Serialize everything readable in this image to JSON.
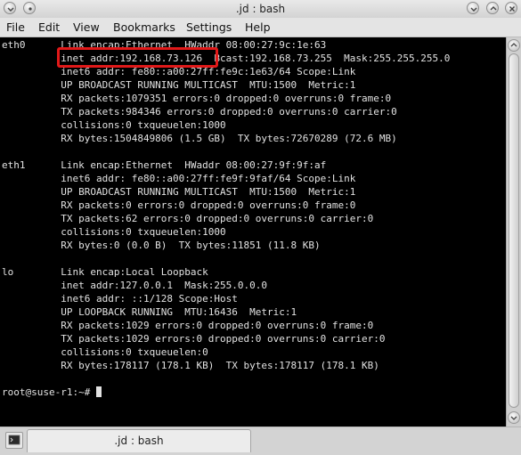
{
  "window": {
    "title": ".jd : bash",
    "icons": [
      "window-menu-icon",
      "pin-icon",
      "minimize-icon",
      "maximize-icon",
      "close-icon"
    ]
  },
  "menubar": {
    "items": [
      {
        "label": "File"
      },
      {
        "label": "Edit"
      },
      {
        "label": "View"
      },
      {
        "label": "Bookmarks"
      },
      {
        "label": "Settings"
      },
      {
        "label": "Help"
      }
    ]
  },
  "terminal": {
    "background": "#000000",
    "text_color": "#e2e2e2",
    "highlight_color": "#e11919",
    "highlighted_text": "inet addr:192.168.73.126",
    "lines": [
      "eth0      Link encap:Ethernet  HWaddr 08:00:27:9c:1e:63",
      "          inet addr:192.168.73.126  Bcast:192.168.73.255  Mask:255.255.255.0",
      "          inet6 addr: fe80::a00:27ff:fe9c:1e63/64 Scope:Link",
      "          UP BROADCAST RUNNING MULTICAST  MTU:1500  Metric:1",
      "          RX packets:1079351 errors:0 dropped:0 overruns:0 frame:0",
      "          TX packets:984346 errors:0 dropped:0 overruns:0 carrier:0",
      "          collisions:0 txqueuelen:1000",
      "          RX bytes:1504849806 (1.5 GB)  TX bytes:72670289 (72.6 MB)",
      "",
      "eth1      Link encap:Ethernet  HWaddr 08:00:27:9f:9f:af",
      "          inet6 addr: fe80::a00:27ff:fe9f:9faf/64 Scope:Link",
      "          UP BROADCAST RUNNING MULTICAST  MTU:1500  Metric:1",
      "          RX packets:0 errors:0 dropped:0 overruns:0 frame:0",
      "          TX packets:62 errors:0 dropped:0 overruns:0 carrier:0",
      "          collisions:0 txqueuelen:1000",
      "          RX bytes:0 (0.0 B)  TX bytes:11851 (11.8 KB)",
      "",
      "lo        Link encap:Local Loopback",
      "          inet addr:127.0.0.1  Mask:255.0.0.0",
      "          inet6 addr: ::1/128 Scope:Host",
      "          UP LOOPBACK RUNNING  MTU:16436  Metric:1",
      "          RX packets:1029 errors:0 dropped:0 overruns:0 frame:0",
      "          TX packets:1029 errors:0 dropped:0 overruns:0 carrier:0",
      "          collisions:0 txqueuelen:0",
      "          RX bytes:178117 (178.1 KB)  TX bytes:178117 (178.1 KB)",
      ""
    ],
    "prompt": "root@suse-r1:~#"
  },
  "tabbar": {
    "tabs": [
      {
        "label": ".jd : bash"
      }
    ],
    "new_tab_icon": "terminal-icon"
  }
}
